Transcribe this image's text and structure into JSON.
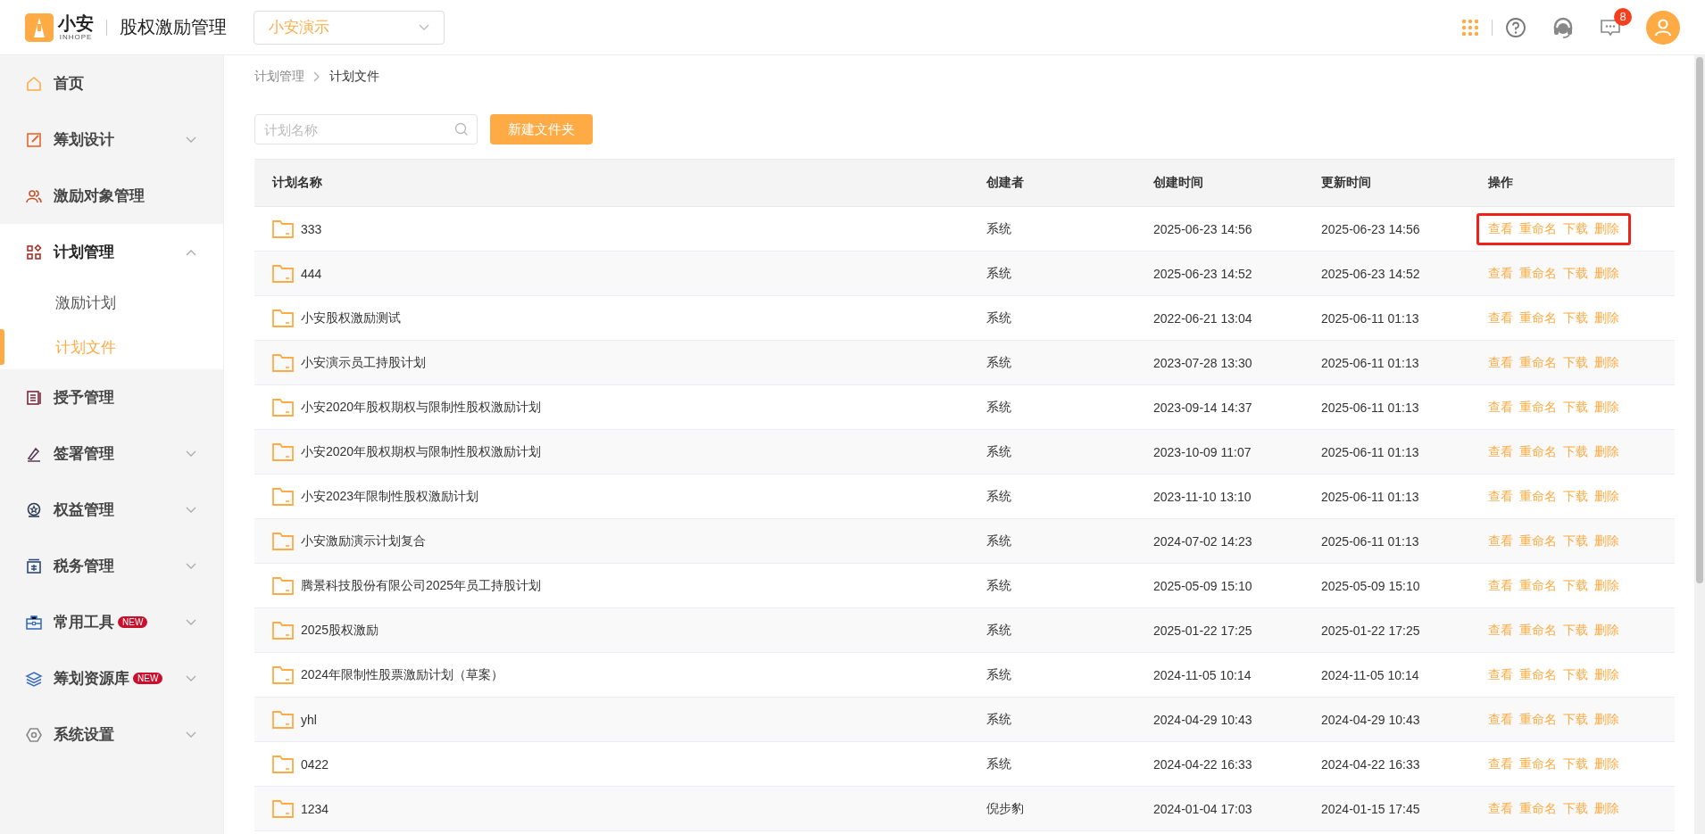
{
  "header": {
    "logo_text": "小安",
    "logo_subtext": "INHOPE",
    "app_title": "股权激励管理",
    "company_select": {
      "value": "小安演示"
    },
    "message_badge": "8"
  },
  "sidebar": {
    "items": [
      {
        "label": "首页",
        "expandable": false,
        "expanded": false
      },
      {
        "label": "筹划设计",
        "expandable": true,
        "expanded": false
      },
      {
        "label": "激励对象管理",
        "expandable": false,
        "expanded": false
      },
      {
        "label": "计划管理",
        "expandable": true,
        "expanded": true,
        "children": [
          {
            "label": "激励计划",
            "selected": false
          },
          {
            "label": "计划文件",
            "selected": true
          }
        ]
      },
      {
        "label": "授予管理",
        "expandable": false,
        "expanded": false
      },
      {
        "label": "签署管理",
        "expandable": true,
        "expanded": false
      },
      {
        "label": "权益管理",
        "expandable": true,
        "expanded": false
      },
      {
        "label": "税务管理",
        "expandable": true,
        "expanded": false
      },
      {
        "label": "常用工具",
        "badge": "NEW",
        "expandable": true,
        "expanded": false
      },
      {
        "label": "筹划资源库",
        "badge": "NEW",
        "expandable": true,
        "expanded": false
      },
      {
        "label": "系统设置",
        "expandable": true,
        "expanded": false
      }
    ]
  },
  "breadcrumb": [
    "计划管理",
    "计划文件"
  ],
  "search": {
    "placeholder": "计划名称"
  },
  "new_folder_button": "新建文件夹",
  "table": {
    "columns": [
      "计划名称",
      "创建者",
      "创建时间",
      "更新时间",
      "操作"
    ],
    "rows": [
      {
        "name": "333",
        "creator": "系统",
        "created": "2025-06-23 14:56",
        "updated": "2025-06-23 14:56",
        "actions": [
          "查看",
          "重命名",
          "下载",
          "删除"
        ],
        "highlighted": true
      },
      {
        "name": "444",
        "creator": "系统",
        "created": "2025-06-23 14:52",
        "updated": "2025-06-23 14:52",
        "actions": [
          "查看",
          "重命名",
          "下载",
          "删除"
        ],
        "highlighted": false
      },
      {
        "name": "小安股权激励测试",
        "creator": "系统",
        "created": "2022-06-21 13:04",
        "updated": "2025-06-11 01:13",
        "actions": [
          "查看",
          "重命名",
          "下载",
          "删除"
        ],
        "highlighted": false
      },
      {
        "name": "小安演示员工持股计划",
        "creator": "系统",
        "created": "2023-07-28 13:30",
        "updated": "2025-06-11 01:13",
        "actions": [
          "查看",
          "重命名",
          "下载",
          "删除"
        ],
        "highlighted": false
      },
      {
        "name": "小安2020年股权期权与限制性股权激励计划",
        "creator": "系统",
        "created": "2023-09-14 14:37",
        "updated": "2025-06-11 01:13",
        "actions": [
          "查看",
          "重命名",
          "下载",
          "删除"
        ],
        "highlighted": false
      },
      {
        "name": "小安2020年股权期权与限制性股权激励计划",
        "creator": "系统",
        "created": "2023-10-09 11:07",
        "updated": "2025-06-11 01:13",
        "actions": [
          "查看",
          "重命名",
          "下载",
          "删除"
        ],
        "highlighted": false
      },
      {
        "name": "小安2023年限制性股权激励计划",
        "creator": "系统",
        "created": "2023-11-10 13:10",
        "updated": "2025-06-11 01:13",
        "actions": [
          "查看",
          "重命名",
          "下载",
          "删除"
        ],
        "highlighted": false
      },
      {
        "name": "小安激励演示计划复合",
        "creator": "系统",
        "created": "2024-07-02 14:23",
        "updated": "2025-06-11 01:13",
        "actions": [
          "查看",
          "重命名",
          "下载",
          "删除"
        ],
        "highlighted": false
      },
      {
        "name": "腾景科技股份有限公司2025年员工持股计划",
        "creator": "系统",
        "created": "2025-05-09 15:10",
        "updated": "2025-05-09 15:10",
        "actions": [
          "查看",
          "重命名",
          "下载",
          "删除"
        ],
        "highlighted": false
      },
      {
        "name": "2025股权激励",
        "creator": "系统",
        "created": "2025-01-22 17:25",
        "updated": "2025-01-22 17:25",
        "actions": [
          "查看",
          "重命名",
          "下载",
          "删除"
        ],
        "highlighted": false
      },
      {
        "name": "2024年限制性股票激励计划（草案）",
        "creator": "系统",
        "created": "2024-11-05 10:14",
        "updated": "2024-11-05 10:14",
        "actions": [
          "查看",
          "重命名",
          "下载",
          "删除"
        ],
        "highlighted": false
      },
      {
        "name": "yhl",
        "creator": "系统",
        "created": "2024-04-29 10:43",
        "updated": "2024-04-29 10:43",
        "actions": [
          "查看",
          "重命名",
          "下载",
          "删除"
        ],
        "highlighted": false
      },
      {
        "name": "0422",
        "creator": "系统",
        "created": "2024-04-22 16:33",
        "updated": "2024-04-22 16:33",
        "actions": [
          "查看",
          "重命名",
          "下载",
          "删除"
        ],
        "highlighted": false
      },
      {
        "name": "1234",
        "creator": "倪步豹",
        "created": "2024-01-04 17:03",
        "updated": "2024-01-15 17:45",
        "actions": [
          "查看",
          "重命名",
          "下载",
          "删除"
        ],
        "highlighted": false
      }
    ]
  }
}
